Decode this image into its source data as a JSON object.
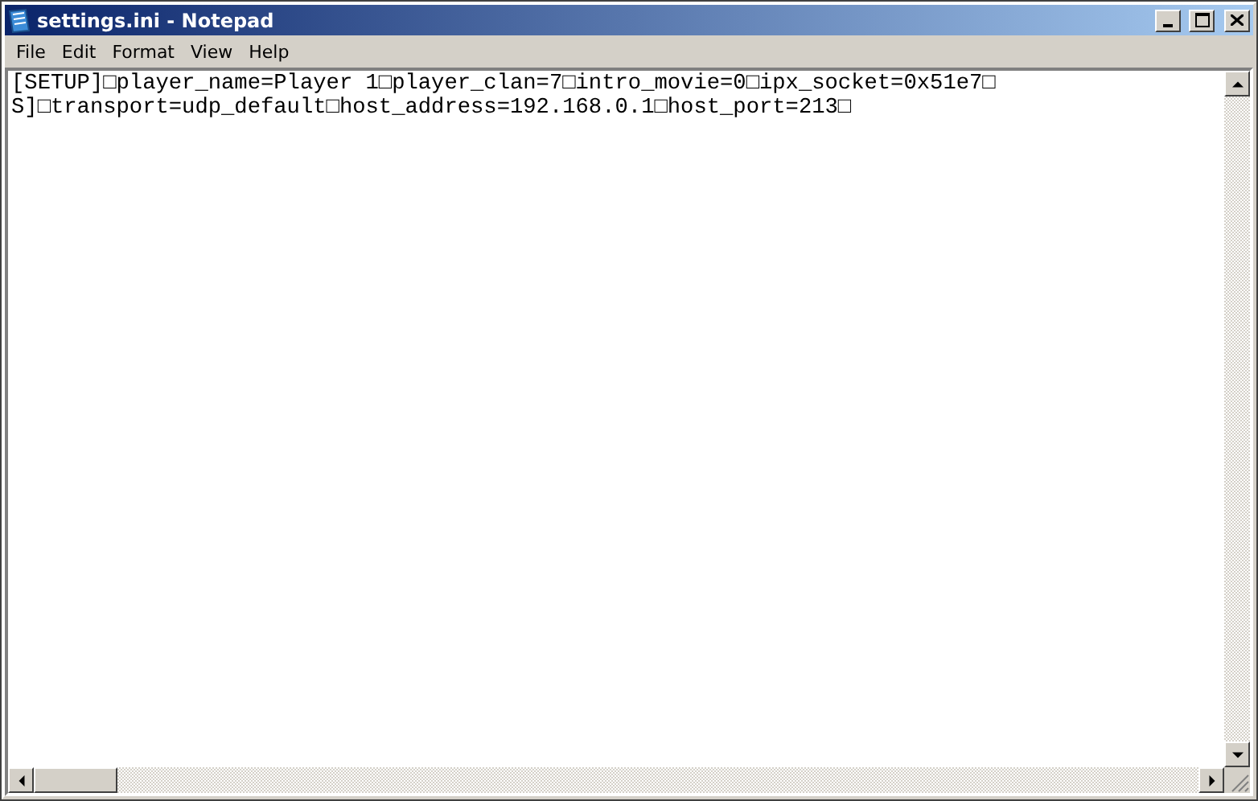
{
  "window": {
    "title": "settings.ini - Notepad"
  },
  "menu": [
    "File",
    "Edit",
    "Format",
    "View",
    "Help"
  ],
  "editor": {
    "lines": [
      "[SETUP]□player_name=Player 1□player_clan=7□intro_movie=0□ipx_socket=0x51e7□",
      "S]□transport=udp_default□host_address=192.168.0.1□host_port=213□"
    ]
  }
}
